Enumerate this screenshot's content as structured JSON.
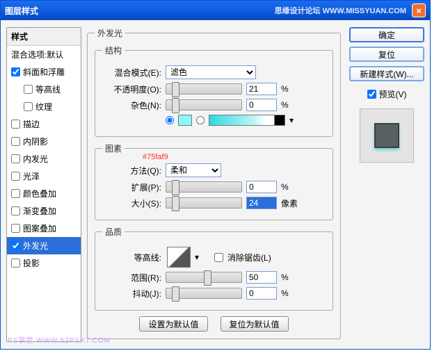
{
  "title": "图层样式",
  "credit": "思缘设计论坛  WWW.MISSYUAN.COM",
  "left": {
    "header": "样式",
    "blend": "混合选项:默认",
    "items": [
      {
        "label": "斜面和浮雕",
        "checked": true
      },
      {
        "label": "等高线",
        "checked": false,
        "sub": true
      },
      {
        "label": "纹理",
        "checked": false,
        "sub": true
      },
      {
        "label": "描边",
        "checked": false
      },
      {
        "label": "内阴影",
        "checked": false
      },
      {
        "label": "内发光",
        "checked": false
      },
      {
        "label": "光泽",
        "checked": false
      },
      {
        "label": "颜色叠加",
        "checked": false
      },
      {
        "label": "渐变叠加",
        "checked": false
      },
      {
        "label": "图案叠加",
        "checked": false
      },
      {
        "label": "外发光",
        "checked": true,
        "selected": true
      },
      {
        "label": "投影",
        "checked": false
      }
    ]
  },
  "main": {
    "group_title": "外发光",
    "hex_note": "#75faf9",
    "structure": {
      "legend": "结构",
      "blend_mode": {
        "label": "混合模式(E):",
        "value": "滤色"
      },
      "opacity": {
        "label": "不透明度(O):",
        "value": "21",
        "unit": "%"
      },
      "noise": {
        "label": "杂色(N):",
        "value": "0",
        "unit": "%"
      }
    },
    "elements": {
      "legend": "图素",
      "method": {
        "label": "方法(Q):",
        "value": "柔和"
      },
      "spread": {
        "label": "扩展(P):",
        "value": "0",
        "unit": "%"
      },
      "size": {
        "label": "大小(S):",
        "value": "24",
        "unit": "像素"
      }
    },
    "quality": {
      "legend": "品质",
      "contour": {
        "label": "等高线:"
      },
      "antialias": {
        "label": "消除锯齿(L)",
        "checked": false
      },
      "range": {
        "label": "范围(R):",
        "value": "50",
        "unit": "%"
      },
      "jitter": {
        "label": "抖动(J):",
        "value": "0",
        "unit": "%"
      }
    },
    "buttons": {
      "make_default": "设置为默认值",
      "reset_default": "复位为默认值"
    }
  },
  "right": {
    "ok": "确定",
    "reset": "复位",
    "new_style": "新建样式(W)...",
    "preview": "预览(V)"
  },
  "footer": "PS学堂  WWW.52PSXT.COM"
}
